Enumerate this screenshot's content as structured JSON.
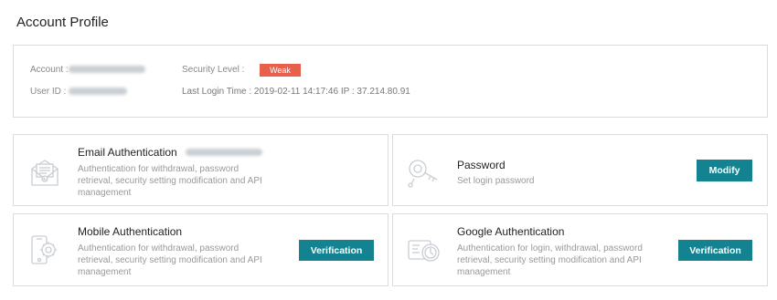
{
  "header": {
    "title": "Account Profile"
  },
  "profile": {
    "account_label": "Account :",
    "userid_label": "User ID :",
    "security_label": "Security Level :",
    "security_value": "Weak",
    "last_login": "Last Login Time : 2019-02-11 14:17:46   IP : 37.214.80.91",
    "badge_color": "#e8604c"
  },
  "cards": {
    "email": {
      "title": "Email Authentication",
      "desc": "Authentication for withdrawal, password retrieval, security setting modification and API management",
      "icon": "envelope-icon"
    },
    "password": {
      "title": "Password",
      "desc": "Set login password",
      "button": "Modify",
      "icon": "key-icon"
    },
    "mobile": {
      "title": "Mobile Authentication",
      "desc": "Authentication for withdrawal, password retrieval, security setting modification and API management",
      "button": "Verification",
      "icon": "phone-gear-icon"
    },
    "google": {
      "title": "Google Authentication",
      "desc": "Authentication for login, withdrawal, password retrieval, security setting modification and API management",
      "button": "Verification",
      "icon": "authenticator-icon"
    }
  },
  "accent_color": "#138392"
}
